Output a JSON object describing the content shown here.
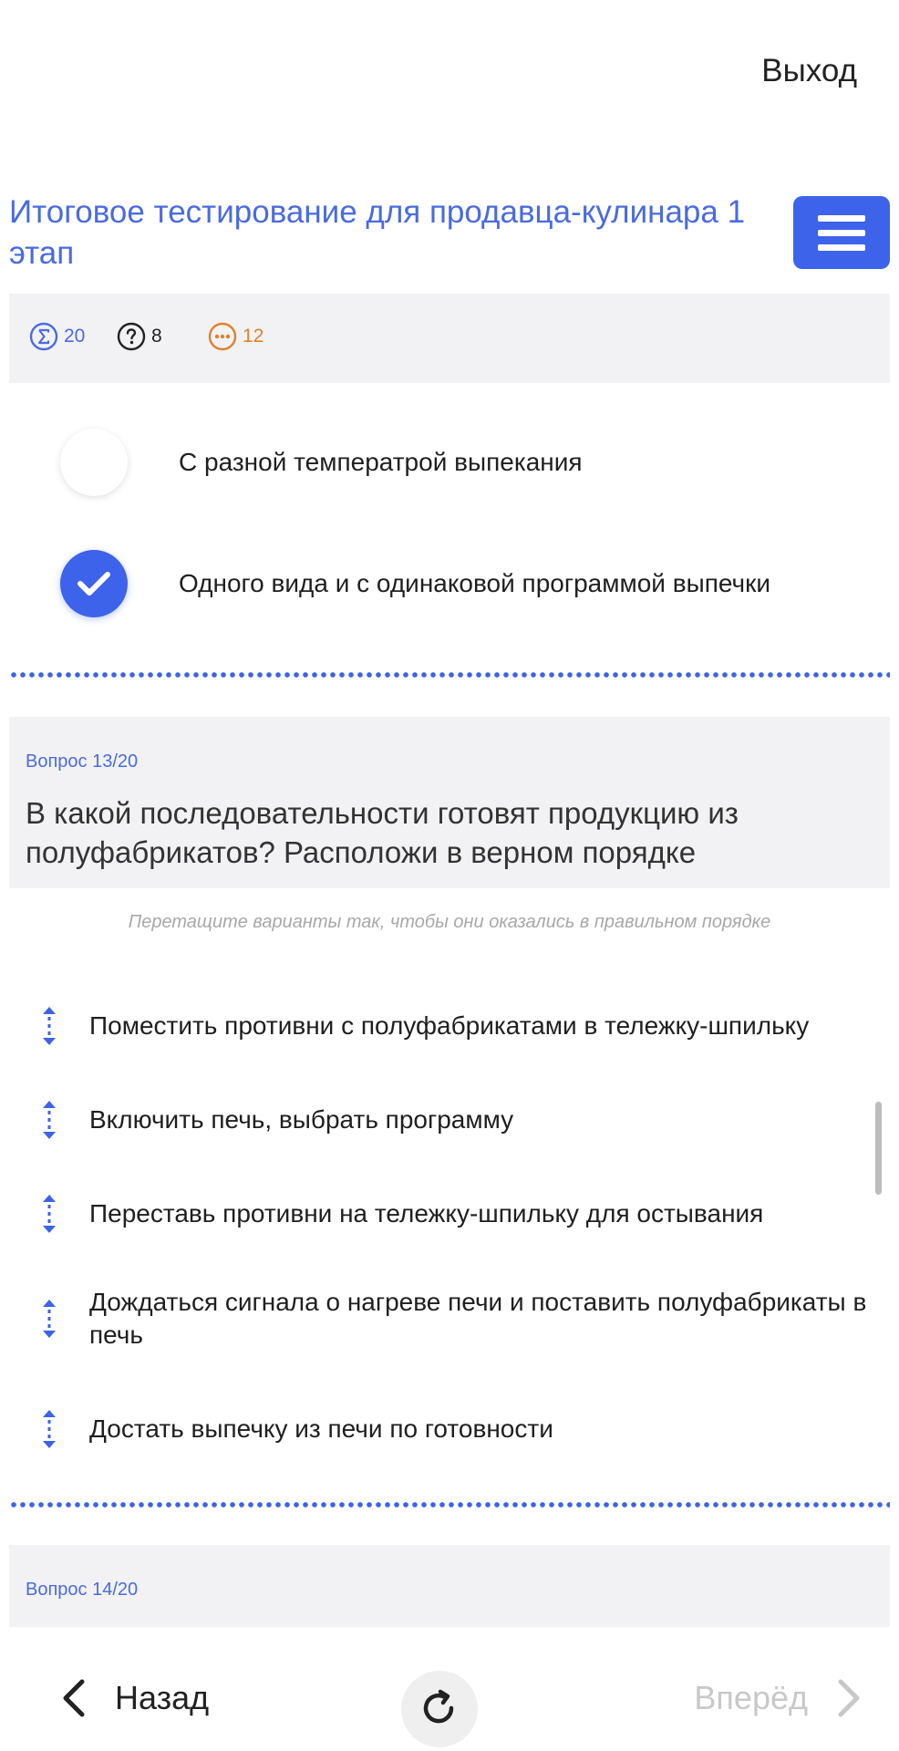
{
  "header": {
    "exit_label": "Выход"
  },
  "test": {
    "title": "Итоговое тестирование для продавца-кулинара 1 этап"
  },
  "stats": {
    "total": "20",
    "questions": "8",
    "remaining": "12"
  },
  "previous_question": {
    "options": [
      {
        "label": "С разной температрой выпекания",
        "selected": false
      },
      {
        "label": "Одного вида и с одинаковой программой выпечки",
        "selected": true
      }
    ]
  },
  "question13": {
    "number": "Вопрос 13/20",
    "text": "В какой последовательности готовят продукцию из полуфабрикатов? Расположи в верном порядке",
    "hint": "Перетащите варианты так, чтобы они оказались в правильном порядке",
    "items": [
      "Поместить противни с полуфабрикатами в тележку-шпильку",
      "Включить печь, выбрать программу",
      "Переставь противни на тележку-шпильку для остывания",
      "Дождаться сигнала о нагреве печи и поставить полуфабрикаты в печь",
      "Достать выпечку из печи по готовности"
    ]
  },
  "question14": {
    "number": "Вопрос 14/20"
  },
  "nav": {
    "back_label": "Назад",
    "next_label": "Вперёд"
  },
  "colors": {
    "accent": "#3d63ea",
    "title": "#4a6be0",
    "orange": "#e0812a",
    "muted": "#c8c8c8"
  }
}
